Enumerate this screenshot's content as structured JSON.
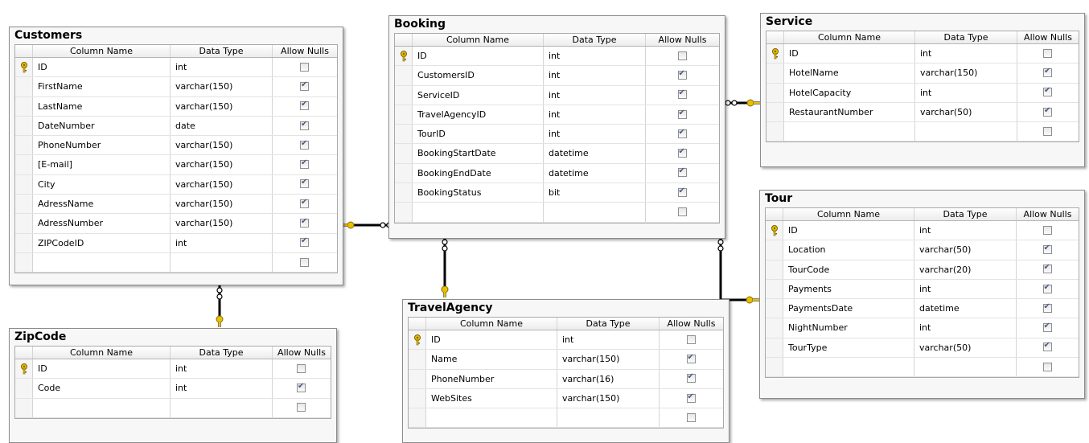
{
  "headers": {
    "column_name": "Column Name",
    "data_type": "Data Type",
    "allow_nulls": "Allow Nulls"
  },
  "tables": {
    "customers": {
      "title": "Customers",
      "columns": [
        {
          "name": "ID",
          "type": "int",
          "nulls": false,
          "pk": true
        },
        {
          "name": "FirstName",
          "type": "varchar(150)",
          "nulls": true
        },
        {
          "name": "LastName",
          "type": "varchar(150)",
          "nulls": true
        },
        {
          "name": "DateNumber",
          "type": "date",
          "nulls": true
        },
        {
          "name": "PhoneNumber",
          "type": "varchar(150)",
          "nulls": true
        },
        {
          "name": "[E-mail]",
          "type": "varchar(150)",
          "nulls": true
        },
        {
          "name": "City",
          "type": "varchar(150)",
          "nulls": true
        },
        {
          "name": "AdressName",
          "type": "varchar(150)",
          "nulls": true
        },
        {
          "name": "AdressNumber",
          "type": "varchar(150)",
          "nulls": true
        },
        {
          "name": "ZIPCodeID",
          "type": "int",
          "nulls": true
        },
        {
          "name": "",
          "type": "",
          "nulls": false
        }
      ]
    },
    "booking": {
      "title": "Booking",
      "columns": [
        {
          "name": "ID",
          "type": "int",
          "nulls": false,
          "pk": true
        },
        {
          "name": "CustomersID",
          "type": "int",
          "nulls": true
        },
        {
          "name": "ServiceID",
          "type": "int",
          "nulls": true
        },
        {
          "name": "TravelAgencyID",
          "type": "int",
          "nulls": true
        },
        {
          "name": "TourID",
          "type": "int",
          "nulls": true
        },
        {
          "name": "BookingStartDate",
          "type": "datetime",
          "nulls": true
        },
        {
          "name": "BookingEndDate",
          "type": "datetime",
          "nulls": true
        },
        {
          "name": "BookingStatus",
          "type": "bit",
          "nulls": true
        },
        {
          "name": "",
          "type": "",
          "nulls": false
        }
      ]
    },
    "service": {
      "title": "Service",
      "columns": [
        {
          "name": "ID",
          "type": "int",
          "nulls": false,
          "pk": true
        },
        {
          "name": "HotelName",
          "type": "varchar(150)",
          "nulls": true
        },
        {
          "name": "HotelCapacity",
          "type": "int",
          "nulls": true
        },
        {
          "name": "RestaurantNumber",
          "type": "varchar(50)",
          "nulls": true
        },
        {
          "name": "",
          "type": "",
          "nulls": false
        }
      ]
    },
    "tour": {
      "title": "Tour",
      "columns": [
        {
          "name": "ID",
          "type": "int",
          "nulls": false,
          "pk": true
        },
        {
          "name": "Location",
          "type": "varchar(50)",
          "nulls": true
        },
        {
          "name": "TourCode",
          "type": "varchar(20)",
          "nulls": true
        },
        {
          "name": "Payments",
          "type": "int",
          "nulls": true
        },
        {
          "name": "PaymentsDate",
          "type": "datetime",
          "nulls": true
        },
        {
          "name": "NightNumber",
          "type": "int",
          "nulls": true
        },
        {
          "name": "TourType",
          "type": "varchar(50)",
          "nulls": true
        },
        {
          "name": "",
          "type": "",
          "nulls": false
        }
      ]
    },
    "travelagency": {
      "title": "TravelAgency",
      "columns": [
        {
          "name": "ID",
          "type": "int",
          "nulls": false,
          "pk": true
        },
        {
          "name": "Name",
          "type": "varchar(150)",
          "nulls": true
        },
        {
          "name": "PhoneNumber",
          "type": "varchar(16)",
          "nulls": true
        },
        {
          "name": "WebSites",
          "type": "varchar(150)",
          "nulls": true
        },
        {
          "name": "",
          "type": "",
          "nulls": false
        }
      ]
    },
    "zipcode": {
      "title": "ZipCode",
      "columns": [
        {
          "name": "ID",
          "type": "int",
          "nulls": false,
          "pk": true
        },
        {
          "name": "Code",
          "type": "int",
          "nulls": true
        },
        {
          "name": "",
          "type": "",
          "nulls": false
        }
      ]
    }
  },
  "colors": {
    "connector": "#000000",
    "key": "#e8c000",
    "check": "#4a5a80"
  },
  "relationships": [
    {
      "from": "customers",
      "to": "booking"
    },
    {
      "from": "service",
      "to": "booking"
    },
    {
      "from": "travelagency",
      "to": "booking"
    },
    {
      "from": "tour",
      "to": "booking"
    },
    {
      "from": "zipcode",
      "to": "customers"
    }
  ]
}
